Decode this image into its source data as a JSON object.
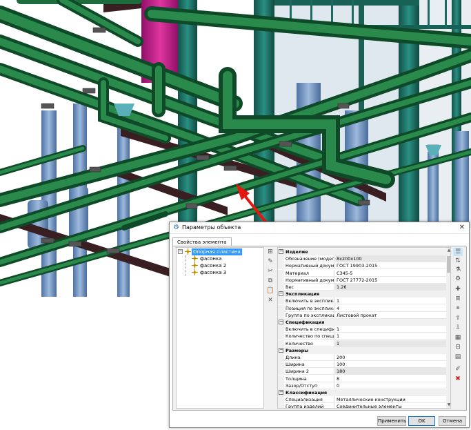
{
  "dialog": {
    "title": "Параметры объекта",
    "close_glyph": "✕",
    "tab_label": "Свойства элемента"
  },
  "tree": {
    "expand_glyph": "−",
    "items": [
      {
        "label": "Опорная пластина",
        "selected": true
      },
      {
        "label": "фасонка"
      },
      {
        "label": "фасонка 2"
      },
      {
        "label": "фасонка 3"
      }
    ]
  },
  "properties": {
    "collapse_glyph": "−",
    "categories": [
      {
        "name": "Изделие",
        "rows": [
          {
            "name": "Обозначение (модель)",
            "value": "8x200x100",
            "shade": true
          },
          {
            "name": "Нормативный документ",
            "value": "ГОСТ 19903-2015"
          },
          {
            "name": "Материал",
            "value": "С345-5"
          },
          {
            "name": "Нормативный документ",
            "value": "ГОСТ 27772-2015"
          },
          {
            "name": "Вес",
            "value": "1.26",
            "shade": true
          }
        ]
      },
      {
        "name": "Экспликация",
        "rows": [
          {
            "name": "Включить в экспликацию",
            "value": "1"
          },
          {
            "name": "Позиция по экспликации",
            "value": "4"
          },
          {
            "name": "Группа по экспликации",
            "value": "Листовой прокат"
          }
        ]
      },
      {
        "name": "Спецификация",
        "rows": [
          {
            "name": "Включить в спецификацию",
            "value": "1"
          },
          {
            "name": "Количество по спецификации",
            "value": "1"
          },
          {
            "name": "Количество",
            "value": "1",
            "shade": true
          }
        ]
      },
      {
        "name": "Размеры",
        "rows": [
          {
            "name": "Длина",
            "value": "200"
          },
          {
            "name": "Ширина",
            "value": "100"
          },
          {
            "name": "Ширина 2",
            "value": "180",
            "shade": true
          },
          {
            "name": "Толщина",
            "value": "8"
          },
          {
            "name": "Зазор/Отступ",
            "value": "0"
          }
        ]
      },
      {
        "name": "Классификация",
        "rows": [
          {
            "name": "Специализация",
            "value": "Металлические конструкции"
          },
          {
            "name": "Группа изделий",
            "value": "Соединительные элементы"
          }
        ]
      }
    ]
  },
  "buttons": {
    "apply": "Применить",
    "ok": "OK",
    "cancel": "Отмена"
  },
  "scroll": {
    "up_glyph": "▲",
    "down_glyph": "▼"
  },
  "colors": {
    "pipe": "#1e6b3c",
    "pipe_dark": "#0f4a28",
    "column": "#6d93c4",
    "steel_teal": "#1f7a6e",
    "beam": "#3a1f22",
    "magenta": "#c2178f",
    "arrow": "#e5170f",
    "selection": "#3399ff"
  }
}
